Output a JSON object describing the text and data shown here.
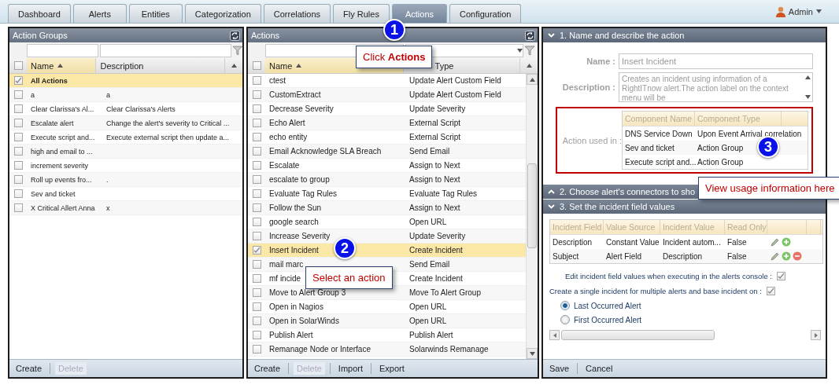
{
  "tabs": [
    {
      "label": "Dashboard",
      "selected": false
    },
    {
      "label": "Alerts",
      "selected": false
    },
    {
      "label": "Entities",
      "selected": false
    },
    {
      "label": "Categorization",
      "selected": false
    },
    {
      "label": "Correlations",
      "selected": false
    },
    {
      "label": "Fly Rules",
      "selected": false
    },
    {
      "label": "Actions",
      "selected": true
    },
    {
      "label": "Configuration",
      "selected": false
    }
  ],
  "user": {
    "name": "Admin"
  },
  "action_groups": {
    "title": "Action Groups",
    "all_checked": false,
    "columns": [
      {
        "label": "Name",
        "sorted": true
      },
      {
        "label": "Description",
        "sorted": false
      }
    ],
    "rows": [
      {
        "name": "All Actions",
        "description": "",
        "checked": true,
        "selected": true
      },
      {
        "name": "a",
        "description": "a",
        "checked": false,
        "selected": false
      },
      {
        "name": "Clear Clarissa's Al...",
        "description": "Clear Clarissa's Alerts",
        "checked": false,
        "selected": false
      },
      {
        "name": "Escalate alert",
        "description": "Change the alert's severity to Critical ...",
        "checked": false,
        "selected": false
      },
      {
        "name": "Execute script and...",
        "description": "Execute external script then update a...",
        "checked": false,
        "selected": false
      },
      {
        "name": "high and email to ...",
        "description": "",
        "checked": false,
        "selected": false
      },
      {
        "name": "increment severity",
        "description": "",
        "checked": false,
        "selected": false
      },
      {
        "name": "Roll up events fro...",
        "description": ".",
        "checked": false,
        "selected": false
      },
      {
        "name": "Sev and ticket",
        "description": "",
        "checked": false,
        "selected": false
      },
      {
        "name": "X Critical Allert Anna",
        "description": "x",
        "checked": false,
        "selected": false
      }
    ],
    "buttons": [
      {
        "label": "Create",
        "disabled": false
      },
      {
        "label": "Delete",
        "disabled": true
      }
    ]
  },
  "actions": {
    "title": "Actions",
    "all_checked": false,
    "columns": [
      {
        "label": "Name",
        "sorted": true
      },
      {
        "label": "Type",
        "sorted": false
      }
    ],
    "rows": [
      {
        "name": "ctest",
        "type": "Update Alert Custom Field",
        "checked": false,
        "selected": false
      },
      {
        "name": "CustomExtract",
        "type": "Update Alert Custom Field",
        "checked": false,
        "selected": false
      },
      {
        "name": "Decrease Severity",
        "type": "Update Severity",
        "checked": false,
        "selected": false
      },
      {
        "name": "Echo Alert",
        "type": "External Script",
        "checked": false,
        "selected": false
      },
      {
        "name": "echo entity",
        "type": "External Script",
        "checked": false,
        "selected": false
      },
      {
        "name": "Email Acknowledge SLA Breach",
        "type": "Send Email",
        "checked": false,
        "selected": false
      },
      {
        "name": "Escalate",
        "type": "Assign to Next",
        "checked": false,
        "selected": false
      },
      {
        "name": "escalate to group",
        "type": "Assign to Next",
        "checked": false,
        "selected": false
      },
      {
        "name": "Evaluate Tag Rules",
        "type": "Evaluate Tag Rules",
        "checked": false,
        "selected": false
      },
      {
        "name": "Follow the Sun",
        "type": "Assign to Next",
        "checked": false,
        "selected": false
      },
      {
        "name": "google search",
        "type": "Open URL",
        "checked": false,
        "selected": false
      },
      {
        "name": "Increase Severity",
        "type": "Update Severity",
        "checked": false,
        "selected": false
      },
      {
        "name": "Insert Incident",
        "type": "Create Incident",
        "checked": true,
        "selected": true
      },
      {
        "name": "mail marc",
        "type": "Send Email",
        "checked": false,
        "selected": false
      },
      {
        "name": "mf incide",
        "type": "Create Incident",
        "checked": false,
        "selected": false
      },
      {
        "name": "Move to Alert Group 3",
        "type": "Move To Alert Group",
        "checked": false,
        "selected": false
      },
      {
        "name": "Open in Nagios",
        "type": "Open URL",
        "checked": false,
        "selected": false
      },
      {
        "name": "Open in SolarWinds",
        "type": "Open URL",
        "checked": false,
        "selected": false
      },
      {
        "name": "Publish Alert",
        "type": "Publish Alert",
        "checked": false,
        "selected": false
      },
      {
        "name": "Remanage Node or Interface",
        "type": "Solarwinds Remanage",
        "checked": false,
        "selected": false
      }
    ],
    "buttons": [
      {
        "label": "Create",
        "disabled": false
      },
      {
        "label": "Delete",
        "disabled": true
      },
      {
        "label": "Import",
        "disabled": false
      },
      {
        "label": "Export",
        "disabled": false
      }
    ]
  },
  "editor": {
    "sections": [
      {
        "title": "1. Name and describe the action",
        "expanded": true
      },
      {
        "title": "2. Choose alert's connectors to sho",
        "expanded": false
      },
      {
        "title": "3. Set the incident field values",
        "expanded": true
      }
    ],
    "name_label": "Name :",
    "name_value": "Insert Incident",
    "description_label": "Description :",
    "description_value": "Creates an incident using information of a RightITnow alert.The action label on the context menu will be",
    "usage": {
      "label": "Action used in :",
      "columns": [
        "Component Name",
        "Component Type"
      ],
      "rows": [
        {
          "name": "DNS Service Down",
          "type": "Upon Event Arrival correlation"
        },
        {
          "name": "Sev and ticket",
          "type": "Action Group"
        },
        {
          "name": "Execute script and...",
          "type": "Action Group"
        }
      ]
    },
    "fields": {
      "columns": [
        "Incident Field",
        "Value Source",
        "Incident Value",
        "Read Only"
      ],
      "rows": [
        {
          "field": "Description",
          "source": "Constant Value",
          "value": "Incident autom...",
          "read_only": "False",
          "removable": false
        },
        {
          "field": "Subject",
          "source": "Alert Field",
          "value": "Description",
          "read_only": "False",
          "removable": true
        }
      ]
    },
    "options": [
      {
        "label": "Edit incident field values when executing in the alerts console :",
        "checked": true
      },
      {
        "label": "Create a single incident for multiple alerts and base incident on  :",
        "checked": true
      }
    ],
    "radios": [
      {
        "label": "Last Occurred Alert",
        "selected": true
      },
      {
        "label": "First Occurred Alert",
        "selected": false
      }
    ],
    "buttons": [
      {
        "label": "Save",
        "disabled": false
      },
      {
        "label": "Cancel",
        "disabled": false
      }
    ]
  },
  "callouts": [
    {
      "number": "1",
      "text": "Click **Actions**"
    },
    {
      "number": "2",
      "text": "Select an action"
    },
    {
      "number": "3",
      "text": "View usage information here"
    }
  ]
}
